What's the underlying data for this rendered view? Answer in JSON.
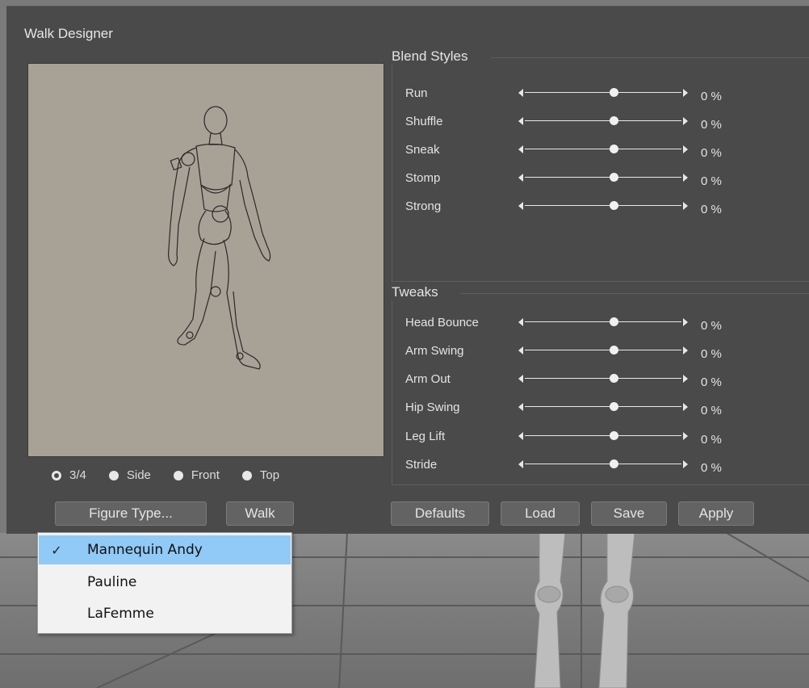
{
  "dialog": {
    "title": "Walk Designer"
  },
  "view_options": [
    {
      "label": "3/4",
      "selected": true
    },
    {
      "label": "Side",
      "selected": false
    },
    {
      "label": "Front",
      "selected": false
    },
    {
      "label": "Top",
      "selected": false
    }
  ],
  "left_buttons": {
    "figure_type": "Figure Type...",
    "walk": "Walk"
  },
  "blend_styles": {
    "title": "Blend Styles",
    "sliders": [
      {
        "label": "Run",
        "value": "0 %"
      },
      {
        "label": "Shuffle",
        "value": "0 %"
      },
      {
        "label": "Sneak",
        "value": "0 %"
      },
      {
        "label": "Stomp",
        "value": "0 %"
      },
      {
        "label": "Strong",
        "value": "0 %"
      }
    ]
  },
  "tweaks": {
    "title": "Tweaks",
    "sliders": [
      {
        "label": "Head Bounce",
        "value": "0 %"
      },
      {
        "label": "Arm Swing",
        "value": "0 %"
      },
      {
        "label": "Arm Out",
        "value": "0 %"
      },
      {
        "label": "Hip Swing",
        "value": "0 %"
      },
      {
        "label": "Leg Lift",
        "value": "0 %"
      },
      {
        "label": "Stride",
        "value": "0 %"
      }
    ]
  },
  "right_buttons": {
    "defaults": "Defaults",
    "load": "Load",
    "save": "Save",
    "apply": "Apply"
  },
  "figure_menu": {
    "items": [
      {
        "label": "Mannequin Andy",
        "checked": true,
        "check_glyph": "✓"
      },
      {
        "label": "Pauline",
        "checked": false,
        "check_glyph": ""
      },
      {
        "label": "LaFemme",
        "checked": false,
        "check_glyph": ""
      }
    ]
  },
  "colors": {
    "dialog_bg": "#4a4a4a",
    "preview_bg": "#a8a195",
    "menu_highlight": "#91c9f7"
  }
}
